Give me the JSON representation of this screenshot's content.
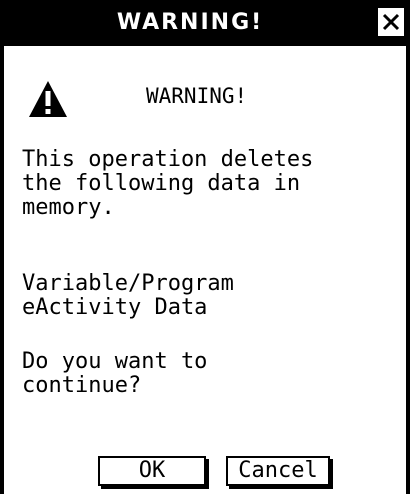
{
  "dialog": {
    "title": "WARNING!",
    "close_icon": "close-icon",
    "icon": "warning-triangle-icon",
    "heading": "WARNING!",
    "message_lines": [
      "This operation deletes\nthe following data in\nmemory.",
      "Variable/Program\neActivity Data",
      "Do you want to\ncontinue?"
    ],
    "buttons": {
      "ok": "OK",
      "cancel": "Cancel"
    }
  },
  "colors": {
    "titlebar_bg": "#000000",
    "titlebar_text": "#ffffff",
    "background": "#ffffff",
    "text": "#000000"
  }
}
